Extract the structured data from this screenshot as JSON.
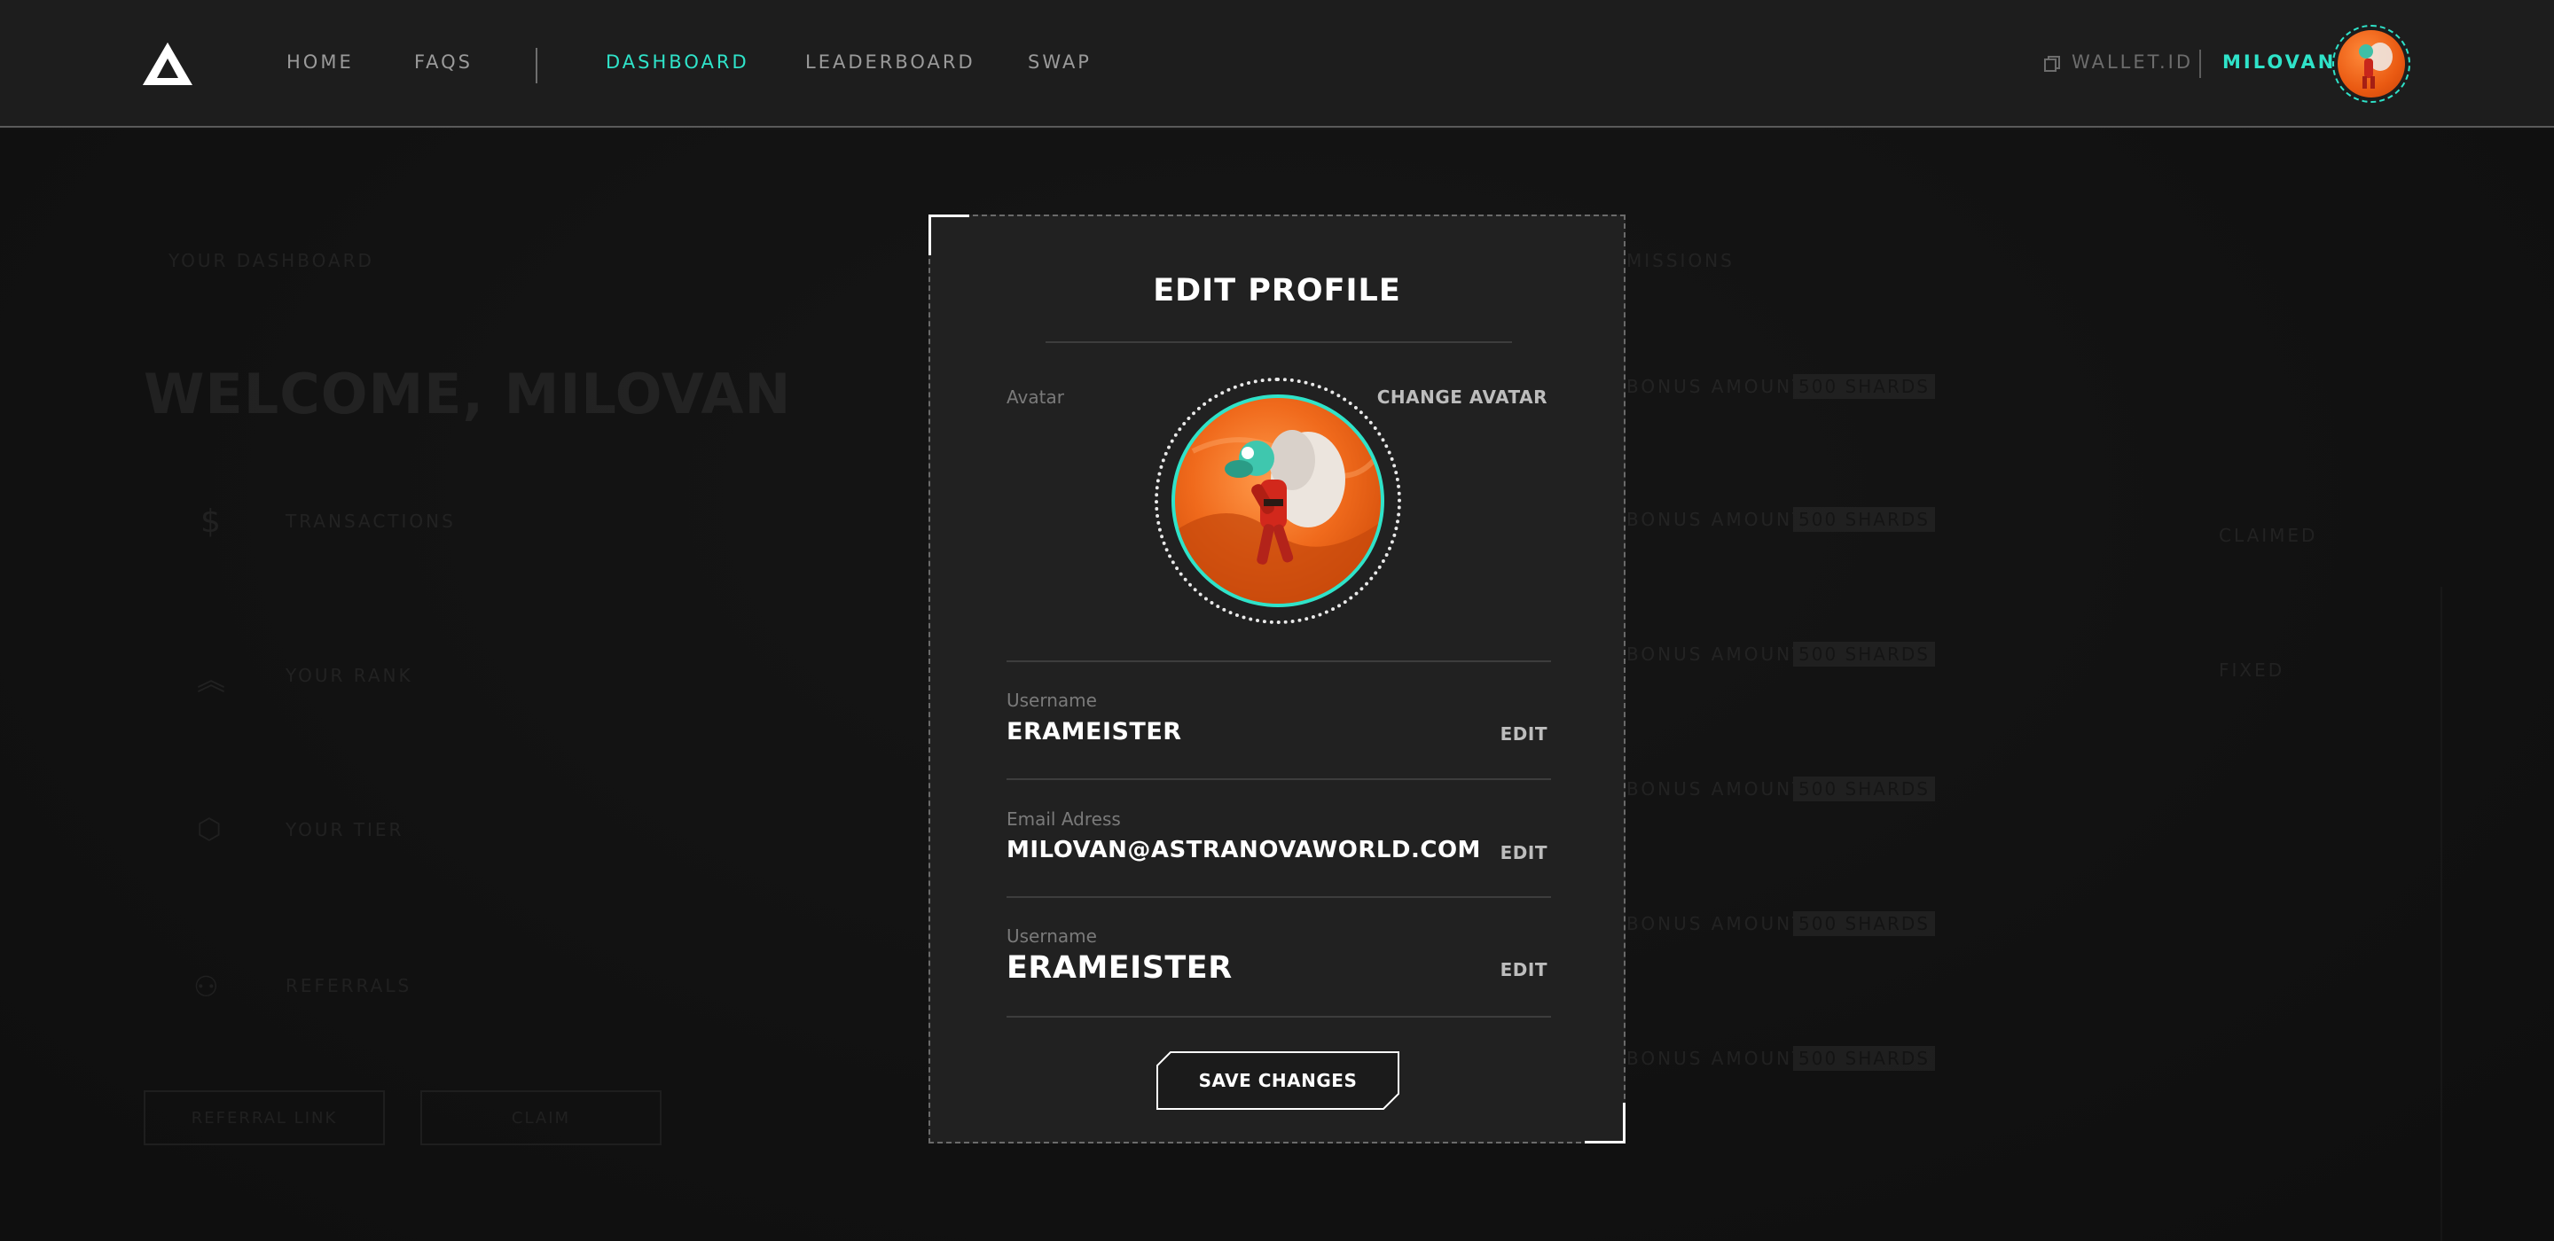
{
  "header": {
    "nav": [
      {
        "label": "HOME"
      },
      {
        "label": "FAQS"
      },
      {
        "label": "DASHBOARD",
        "active": true
      },
      {
        "label": "LEADERBOARD"
      },
      {
        "label": "SWAP"
      }
    ],
    "wallet_label": "WALLET.ID",
    "user_name": "MILOVAN",
    "accent_color": "#2fe3c9"
  },
  "background_dashboard": {
    "section_tab": "YOUR DASHBOARD",
    "missions_tab": "MISSIONS",
    "welcome": "WELCOME, MILOVAN",
    "left_items": [
      {
        "icon": "dollar-icon",
        "label": "TRANSACTIONS"
      },
      {
        "icon": "rank-chevrons-icon",
        "label": "YOUR RANK"
      },
      {
        "icon": "shield-icon",
        "label": "YOUR TIER"
      },
      {
        "icon": "users-icon",
        "label": "REFERRALS"
      }
    ],
    "right_rows": [
      {
        "label": "BONUS AMOUNT",
        "badge": "500 SHARDS"
      },
      {
        "label": "BONUS AMOUNT",
        "badge": "500 SHARDS",
        "action": "CLAIMED"
      },
      {
        "label": "BONUS AMOUNT",
        "badge": "500 SHARDS",
        "action": "FIXED"
      },
      {
        "label": "BONUS AMOUNT",
        "badge": "500 SHARDS"
      },
      {
        "label": "BONUS AMOUNT",
        "badge": "500 SHARDS"
      },
      {
        "label": "BONUS AMOUNT",
        "badge": "500 SHARDS"
      }
    ],
    "buttons": {
      "referral": "REFERRAL LINK",
      "claim": "CLAIM"
    }
  },
  "modal": {
    "title": "EDIT PROFILE",
    "avatar_label": "Avatar",
    "change_avatar": "CHANGE AVATAR",
    "fields": [
      {
        "label": "Username",
        "value": "ERAMEISTER",
        "action": "EDIT"
      },
      {
        "label": "Email Adress",
        "value": "MILOVAN@ASTRANOVAWORLD.COM",
        "action": "EDIT"
      },
      {
        "label": "Username",
        "value": "ERAMEISTER",
        "action": "EDIT"
      }
    ],
    "save_button": "SAVE CHANGES"
  }
}
